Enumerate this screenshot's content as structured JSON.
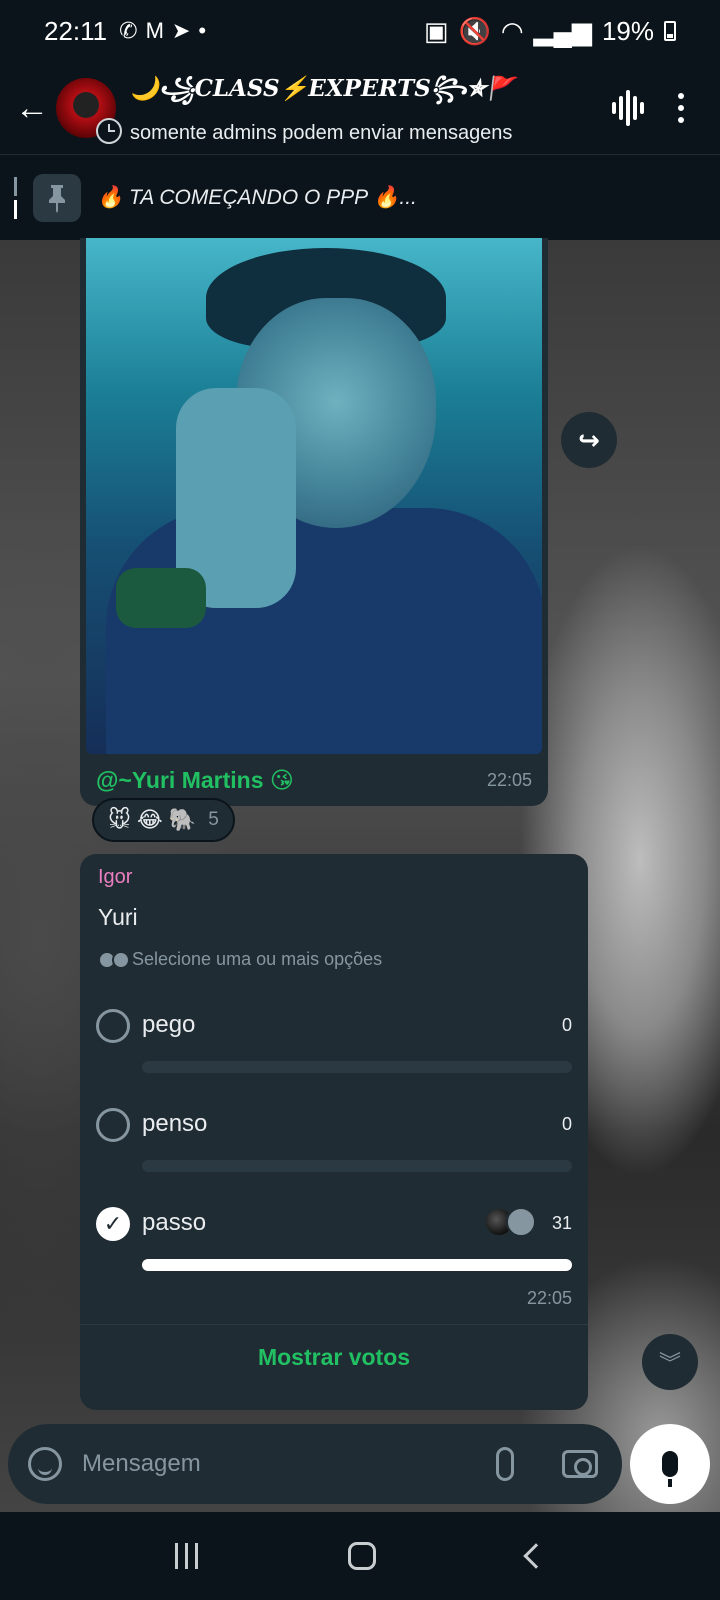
{
  "status_bar": {
    "time": "22:11",
    "left_icons": [
      "whatsapp-icon",
      "gmail-icon",
      "telegram-icon",
      "dot"
    ],
    "battery": "19%",
    "right_icons": [
      "battery-saver-icon",
      "mute-icon",
      "wifi-icon",
      "signal-icon",
      "battery-icon"
    ]
  },
  "header": {
    "title": "🌙꧁CLASS⚡EXPERTS꧂✯🚩",
    "subtitle": "somente admins podem enviar mensagens"
  },
  "pinned": {
    "text": "🔥 TA COMEÇANDO O PPP 🔥..."
  },
  "image_message": {
    "caption": "@~Yuri Martins 😘",
    "time": "22:05"
  },
  "reactions": {
    "emojis": "🐭 😂 🐘",
    "count": "5"
  },
  "poll": {
    "sender": "Igor",
    "question": "Yuri",
    "hint": "Selecione uma ou mais opções",
    "options": [
      {
        "label": "pego",
        "count": "0",
        "fraction": 0,
        "checked": false
      },
      {
        "label": "penso",
        "count": "0",
        "fraction": 0,
        "checked": false
      },
      {
        "label": "passo",
        "count": "31",
        "fraction": 1,
        "checked": true
      }
    ],
    "time": "22:05",
    "show_votes": "Mostrar votos"
  },
  "input": {
    "placeholder": "Mensagem"
  },
  "colors": {
    "background": "#0b141a",
    "bubble": "#202c33",
    "accent": "#21c063",
    "sender": "#e97ec0"
  }
}
